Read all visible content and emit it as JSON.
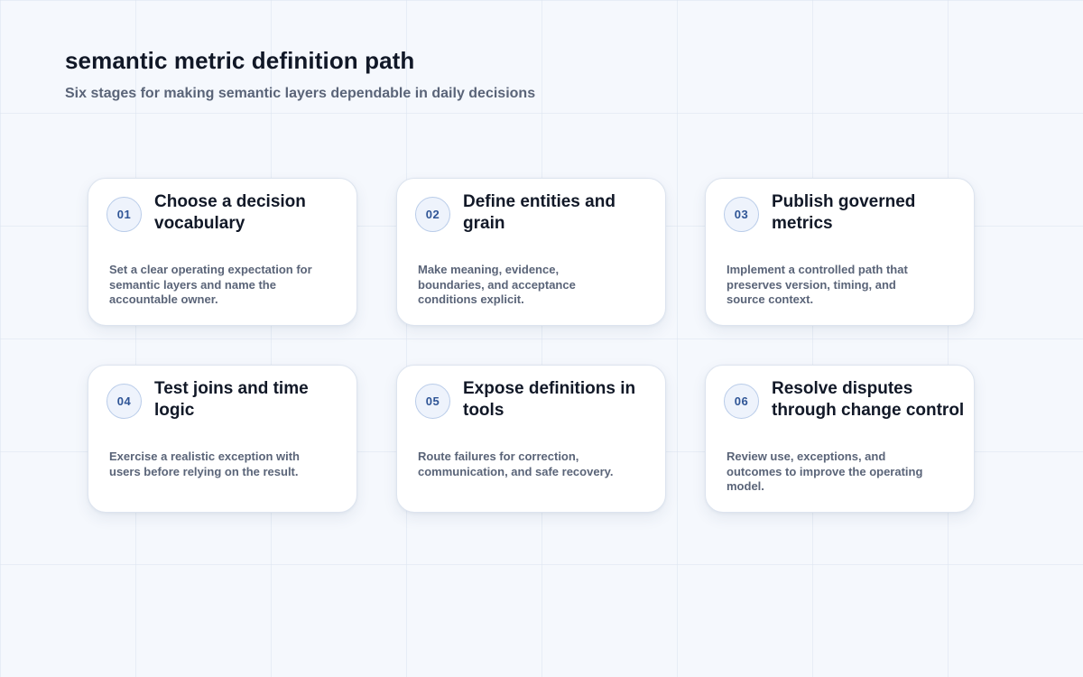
{
  "header": {
    "title": "semantic metric definition path",
    "subtitle": "Six stages for making semantic layers dependable in daily decisions"
  },
  "stages": [
    {
      "number": "01",
      "title": "Choose a decision vocabulary",
      "description": "Set a clear operating expectation for semantic layers and name the accountable owner."
    },
    {
      "number": "02",
      "title": "Define entities and grain",
      "description": "Make meaning, evidence, boundaries, and acceptance conditions explicit."
    },
    {
      "number": "03",
      "title": "Publish governed metrics",
      "description": "Implement a controlled path that preserves version, timing, and source context."
    },
    {
      "number": "04",
      "title": "Test joins and time logic",
      "description": "Exercise a realistic exception with users before relying on the result."
    },
    {
      "number": "05",
      "title": "Expose definitions in tools",
      "description": "Route failures for correction, communication, and safe recovery."
    },
    {
      "number": "06",
      "title": "Resolve disputes through change control",
      "description": "Review use, exceptions, and outcomes to improve the operating model."
    }
  ]
}
